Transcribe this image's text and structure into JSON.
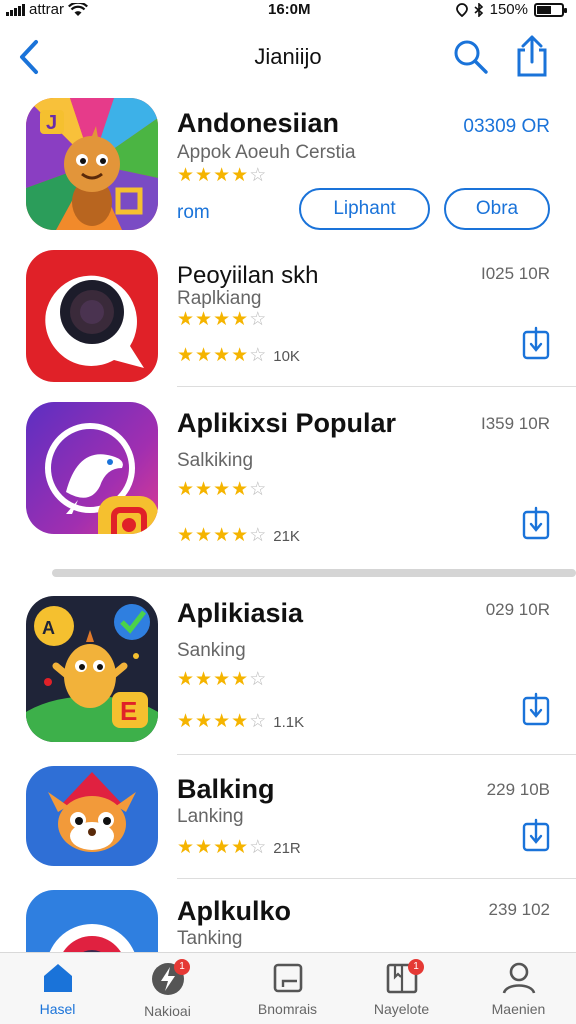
{
  "status_bar": {
    "carrier": "attrar",
    "time": "16:0M",
    "battery": "150%"
  },
  "nav": {
    "title": "Jianiijo"
  },
  "colors": {
    "accent": "#1a73d9",
    "star": "#f5b400",
    "badge": "#e53935"
  },
  "apps": [
    {
      "name": "Andonesiian",
      "subtitle": "Appok Aoeuh Cerstia",
      "price": "03309 OR",
      "rating": 4,
      "link_text": "rom",
      "buttons": [
        "Liphant",
        "Obra"
      ]
    },
    {
      "name": "Peoyiilan skh",
      "subtitle": "Raplkiang",
      "price": "I025 10R",
      "rating": 4,
      "rating_count": "10K"
    },
    {
      "name": "Aplikixsi Popular",
      "subtitle": "Salkiking",
      "price": "I359 10R",
      "rating": 4,
      "rating_count": "21K"
    },
    {
      "name": "Aplikiasia",
      "subtitle": "Sanking",
      "price": "029 10R",
      "rating": 4,
      "rating_count": "1.1K"
    },
    {
      "name": "Balking",
      "subtitle": "Lanking",
      "price": "229 10B",
      "rating": 4,
      "rating_count": "21R"
    },
    {
      "name": "Aplkulko",
      "subtitle": "Tanking",
      "price": "239 102"
    }
  ],
  "tabs": [
    {
      "label": "Hasel",
      "icon": "home-icon",
      "active": true
    },
    {
      "label": "Nakioai",
      "icon": "bolt-icon",
      "badge": "1"
    },
    {
      "label": "Bnomrais",
      "icon": "square-icon"
    },
    {
      "label": "Nayelote",
      "icon": "book-icon",
      "badge": "1"
    },
    {
      "label": "Maenien",
      "icon": "person-icon"
    }
  ]
}
